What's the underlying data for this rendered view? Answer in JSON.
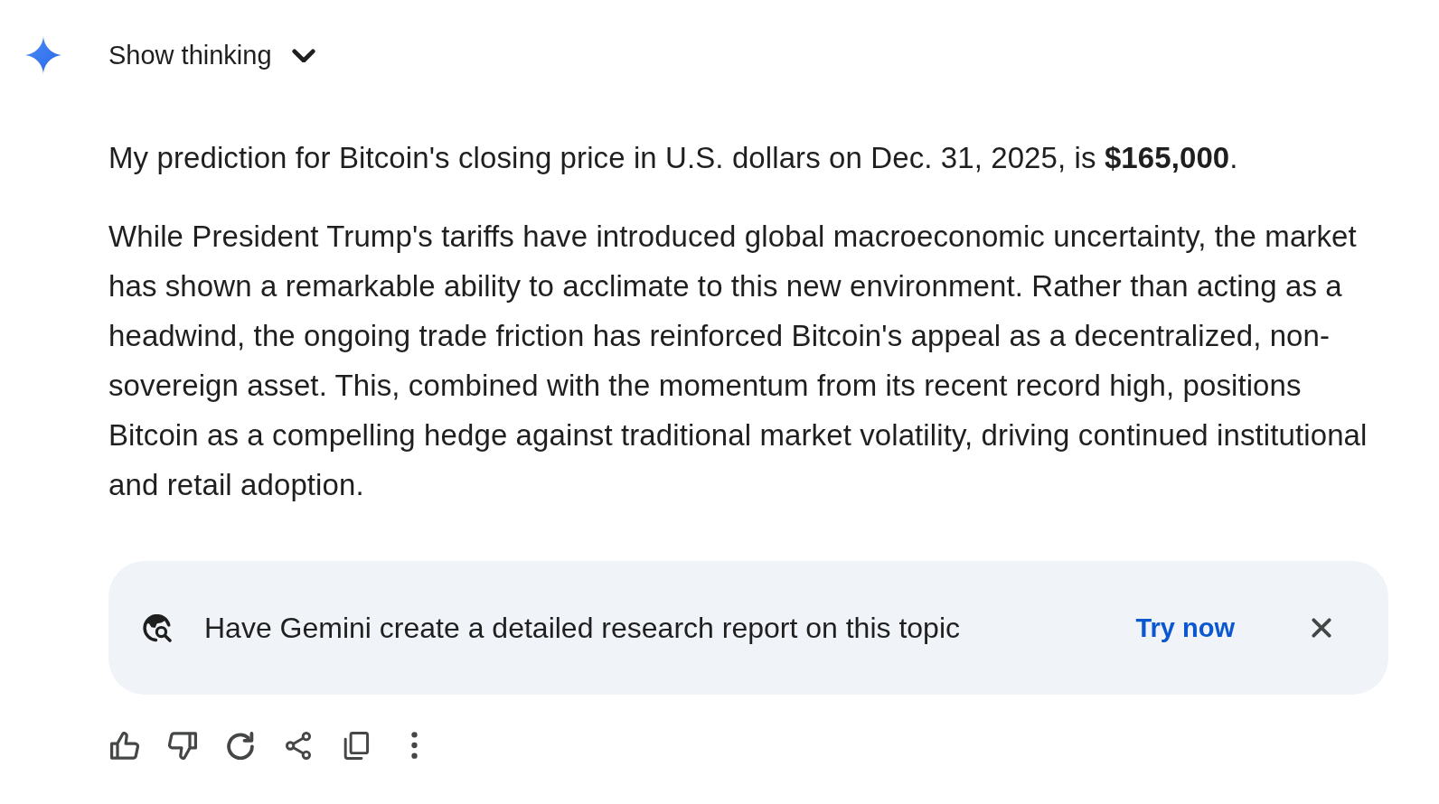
{
  "header": {
    "label": "Show thinking",
    "expanded": false
  },
  "response": {
    "paragraphs": [
      "My prediction for Bitcoin's closing price in U.S. dollars on Dec. 31, 2025, is **$165,000**.",
      "While President Trump's tariffs have introduced global macroeconomic uncertainty, the market has shown a remarkable ability to acclimate to this new environment. Rather than acting as a headwind, the ongoing trade friction has reinforced Bitcoin's appeal as a decentralized, non-sovereign asset. This, combined with the momentum from its recent record high, positions Bitcoin as a compelling hedge against traditional market volatility, driving continued institutional and retail adoption."
    ]
  },
  "research_banner": {
    "text": "Have Gemini create a detailed research report on this topic",
    "action": "Try now"
  }
}
